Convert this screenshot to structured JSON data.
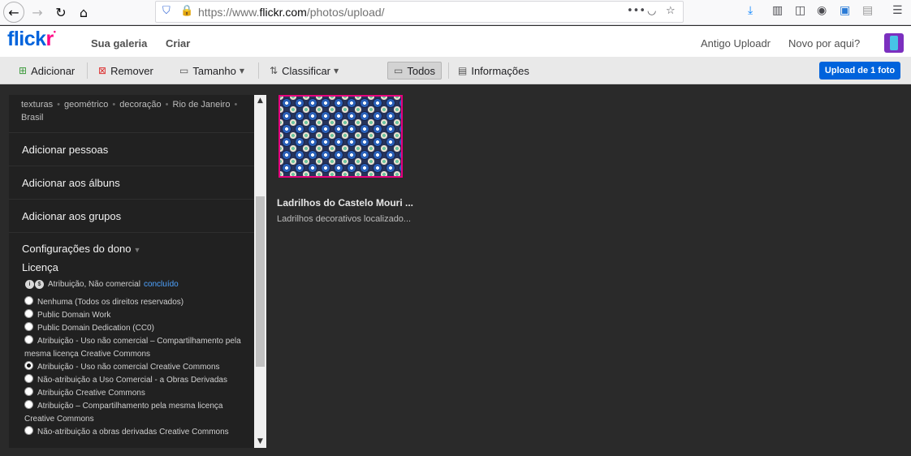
{
  "browser": {
    "url_prefix": "https://www.",
    "url_domain": "flickr.com",
    "url_path": "/photos/upload/"
  },
  "header": {
    "logo_main": "flick",
    "logo_accent": "r",
    "nav": [
      "Sua galeria",
      "Criar"
    ],
    "right_links": [
      "Antigo Uploadr",
      "Novo por aqui?"
    ]
  },
  "toolbar": {
    "add": "Adicionar",
    "remove": "Remover",
    "size": "Tamanho",
    "sort": "Classificar",
    "all": "Todos",
    "info": "Informações",
    "upload": "Upload de 1 foto"
  },
  "sidebar": {
    "tags": [
      "texturas",
      "geométrico",
      "decoração",
      "Rio de Janeiro",
      "Brasil"
    ],
    "add_people": "Adicionar pessoas",
    "add_albums": "Adicionar aos álbuns",
    "add_groups": "Adicionar aos grupos",
    "owner_settings": "Configurações do dono",
    "license_title": "Licença",
    "license_current": "Atribuição, Não comercial",
    "license_done": "concluído",
    "options": [
      "Nenhuma (Todos os direitos reservados)",
      "Public Domain Work",
      "Public Domain Dedication (CC0)",
      "Atribuição - Uso não comercial – Compartilhamento pela mesma licença Creative Commons",
      "Atribuição - Uso não comercial Creative Commons",
      "Não-atribuição a Uso Comercial - a Obras Derivadas",
      "Atribuição Creative Commons",
      "Atribuição – Compartilhamento pela mesma licença Creative Commons",
      "Não-atribuição a obras derivadas Creative Commons"
    ],
    "selected_index": 4
  },
  "photo": {
    "title": "Ladrilhos do Castelo Mouri ...",
    "description": "Ladrilhos decorativos localizado..."
  },
  "colors": {
    "brand_blue": "#0063dc",
    "brand_pink": "#ff0084",
    "selection": "#e6007e"
  }
}
